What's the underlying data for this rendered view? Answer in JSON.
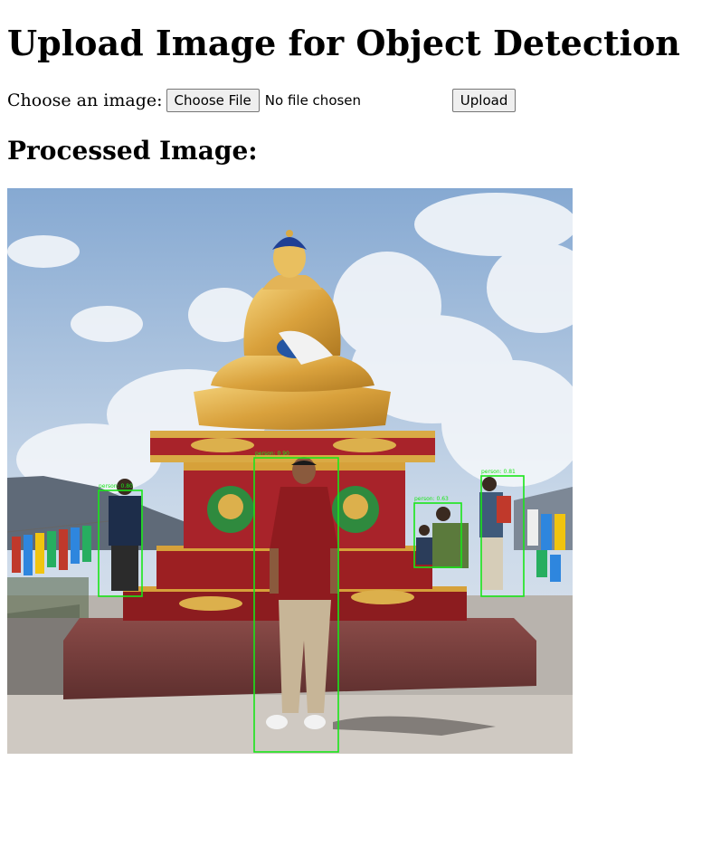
{
  "page": {
    "title": "Upload Image for Object Detection",
    "subtitle": "Processed Image:"
  },
  "form": {
    "label": "Choose an image:",
    "choose_button": "Choose File",
    "file_status": "No file chosen",
    "upload_button": "Upload"
  },
  "image": {
    "detections": [
      {
        "label": "person: 0.80"
      },
      {
        "label": "person: 0.90"
      },
      {
        "label": "person: 0.63"
      },
      {
        "label": "person: 0.81"
      }
    ],
    "box_color": "#19e619"
  }
}
